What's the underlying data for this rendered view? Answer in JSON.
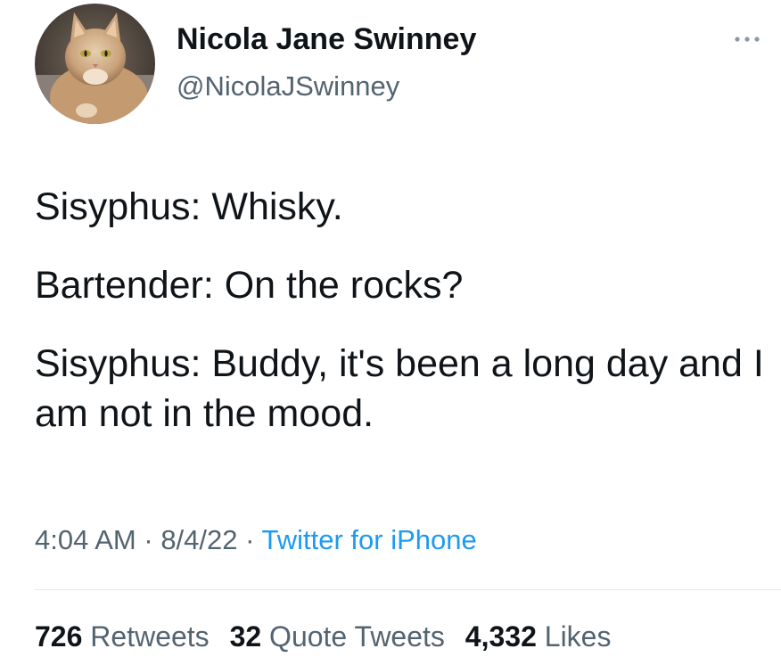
{
  "author": {
    "display_name": "Nicola Jane Swinney",
    "handle": "@NicolaJSwinney",
    "avatar_icon": "cat-avatar"
  },
  "more_icon": "more-options-icon",
  "tweet": {
    "lines": [
      "Sisyphus: Whisky.",
      "Bartender: On the rocks?",
      "Sisyphus: Buddy, it's been a long day and I am not in the mood."
    ]
  },
  "meta": {
    "time": "4:04 AM",
    "separator1": " · ",
    "date": "8/4/22",
    "separator2": " · ",
    "source": "Twitter for iPhone"
  },
  "stats": {
    "retweets_count": "726",
    "retweets_label": "Retweets",
    "quotes_count": "32",
    "quotes_label": "Quote Tweets",
    "likes_count": "4,332",
    "likes_label": "Likes"
  },
  "colors": {
    "text_primary": "#0f1419",
    "text_secondary": "#536471",
    "link": "#1d9bf0",
    "divider": "#e6e9eb"
  }
}
